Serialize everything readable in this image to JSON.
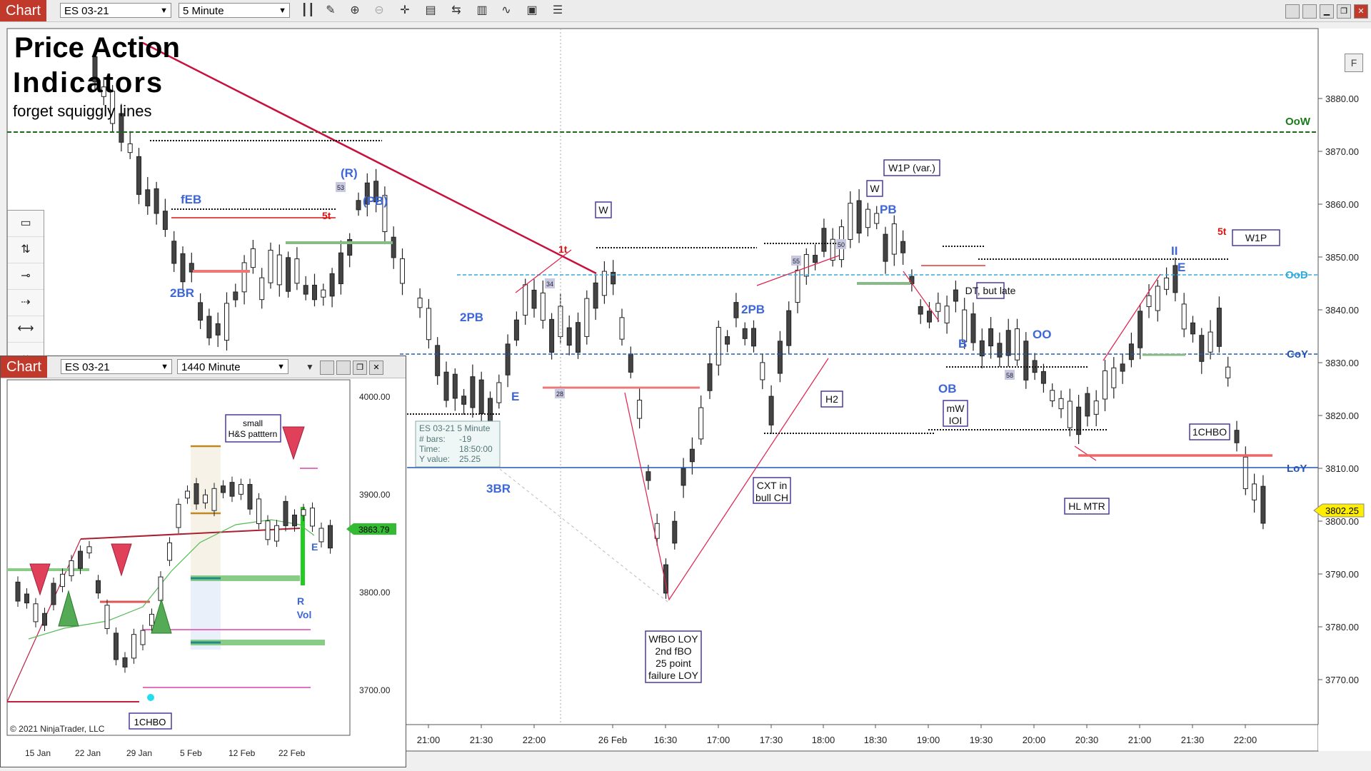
{
  "window": {
    "tab": "Chart",
    "instrument": "ES 03-21",
    "interval": "5 Minute"
  },
  "header": {
    "title_line1": "Price Action",
    "title_line2": "Indicators",
    "subtitle": "forget squiggly lines"
  },
  "right_axis": {
    "ticks": [
      "3880.00",
      "3870.00",
      "3860.00",
      "3850.00",
      "3840.00",
      "3830.00",
      "3820.00",
      "3810.00",
      "3800.00",
      "3790.00",
      "3780.00",
      "3770.00"
    ],
    "levels": [
      {
        "label": "OoW",
        "color": "#1a7a1a"
      },
      {
        "label": "OoD",
        "color": "#33aadd"
      },
      {
        "label": "CoY",
        "color": "#2255bb"
      },
      {
        "label": "LoY",
        "color": "#2255bb"
      }
    ],
    "current_price": "3802.25"
  },
  "time_axis": [
    "21:00",
    "21:30",
    "22:00",
    "26 Feb",
    "16:30",
    "17:00",
    "17:30",
    "18:00",
    "18:30",
    "19:00",
    "19:30",
    "20:00",
    "20:30",
    "21:00",
    "21:30",
    "22:00"
  ],
  "annotations": {
    "boxed": [
      "W",
      "W",
      "W1P (var.)",
      "W1P",
      "DT, but late",
      "H2",
      "mW\nIOI",
      "CXT in\nbull CH",
      "HL MTR",
      "1CHBO",
      "WfBO LOY\n2nd fBO\n25 point\nfailure LOY"
    ],
    "blue": [
      "fEB",
      "2BR",
      "(R)",
      "(PB)",
      "2PB",
      "E",
      "3BR",
      "2PB",
      "PB",
      "B",
      "OB",
      "OO",
      "E",
      "II"
    ],
    "red": [
      "1t",
      "5t",
      "5t"
    ],
    "small_counts": [
      "53",
      "34",
      "28",
      "55",
      "50",
      "58"
    ]
  },
  "info_box": {
    "line1": "ES 03-21 5 Minute",
    "line2_label": "# bars:",
    "line2_val": "-19",
    "line3_label": "Time:",
    "line3_val": "18:50:00",
    "line4_label": "Y value:",
    "line4_val": "25.25"
  },
  "inset": {
    "tab": "Chart",
    "instrument": "ES 03-21",
    "interval": "1440 Minute",
    "ticks": [
      "4000.00",
      "3900.00",
      "3800.00",
      "3700.00"
    ],
    "current_price": "3863.79",
    "dates": [
      "15 Jan",
      "22 Jan",
      "29 Jan",
      "5 Feb",
      "12 Feb",
      "22 Feb"
    ],
    "labels": {
      "hs": "small\nH&S patttern",
      "r": "R",
      "vol": "Vol",
      "e": "E",
      "chbo": "1CHBO"
    },
    "copyright": "© 2021 NinjaTrader, LLC"
  },
  "f_button": "F"
}
